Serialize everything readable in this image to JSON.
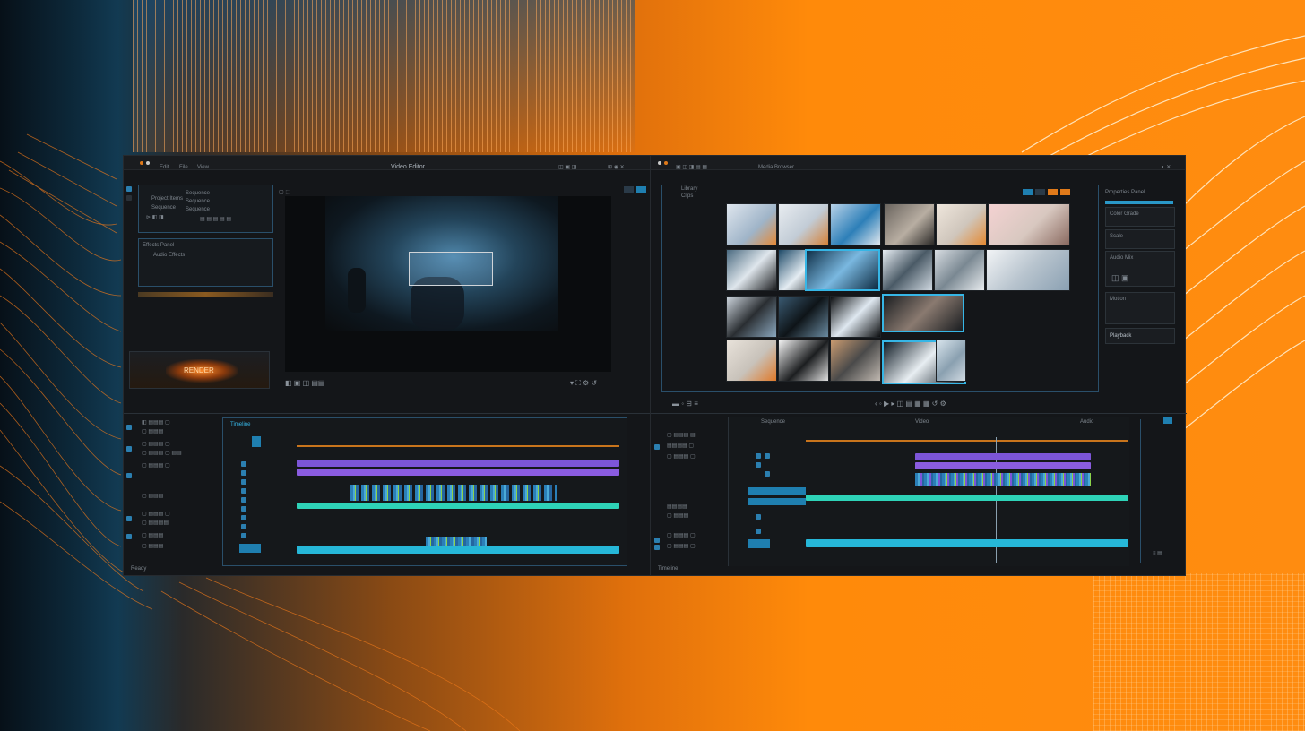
{
  "background": {
    "colors": {
      "left": "#0d2a3c",
      "right": "#ff8a0a",
      "accent": "#36b6e6"
    }
  },
  "left_window": {
    "title": "Video Editor",
    "menu_items": [
      "Edit",
      "File",
      "View"
    ],
    "project_panel": {
      "label": "Project Items",
      "rows": [
        "Sequence",
        "Sequence",
        "Sequence",
        "Sequence"
      ]
    },
    "effects_panel": {
      "label": "Effects Panel",
      "row": "Audio Effects"
    },
    "thumbnail_caption": "RENDER",
    "timeline_header": "Timeline",
    "status": "Ready"
  },
  "right_window": {
    "title": "Media Browser",
    "tabs": [
      "Library",
      "Clips"
    ],
    "inspector": {
      "header": "Properties Panel",
      "items": [
        "Color Grade",
        "Scale",
        "Audio Mix",
        "Motion",
        "Playback"
      ]
    },
    "timeline_labels": [
      "Sequence",
      "Video",
      "Audio"
    ],
    "status": "Timeline"
  },
  "icons": [
    "play-icon",
    "pause-icon",
    "scissors-icon",
    "settings-icon",
    "zoom-icon"
  ]
}
